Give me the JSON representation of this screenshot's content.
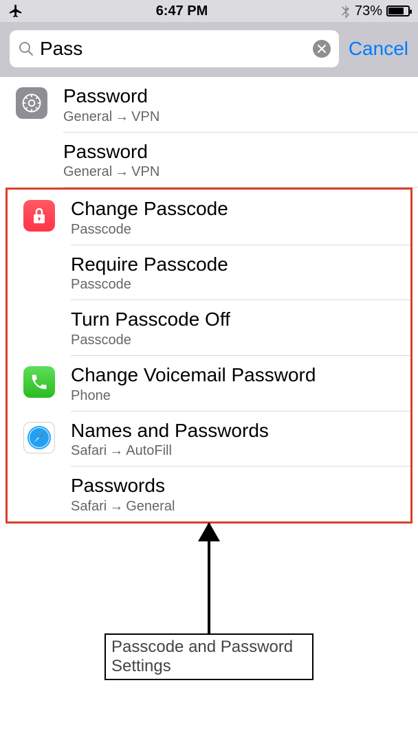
{
  "status": {
    "time": "6:47 PM",
    "battery_pct": "73%"
  },
  "search": {
    "value": "Pass",
    "cancel_label": "Cancel"
  },
  "results": [
    {
      "icon": "settings",
      "title": "Password",
      "path_a": "General",
      "path_b": "VPN"
    },
    {
      "icon": "",
      "title": "Password",
      "path_a": "General",
      "path_b": "VPN"
    },
    {
      "icon": "passcode",
      "title": "Change Passcode",
      "path_a": "Passcode",
      "path_b": ""
    },
    {
      "icon": "",
      "title": "Require Passcode",
      "path_a": "Passcode",
      "path_b": ""
    },
    {
      "icon": "",
      "title": "Turn Passcode Off",
      "path_a": "Passcode",
      "path_b": ""
    },
    {
      "icon": "phone",
      "title": "Change Voicemail Password",
      "path_a": "Phone",
      "path_b": ""
    },
    {
      "icon": "safari",
      "title": "Names and Passwords",
      "path_a": "Safari",
      "path_b": "AutoFill"
    },
    {
      "icon": "",
      "title": "Passwords",
      "path_a": "Safari",
      "path_b": "General"
    }
  ],
  "annotation": {
    "caption": "Passcode and Password Settings"
  }
}
